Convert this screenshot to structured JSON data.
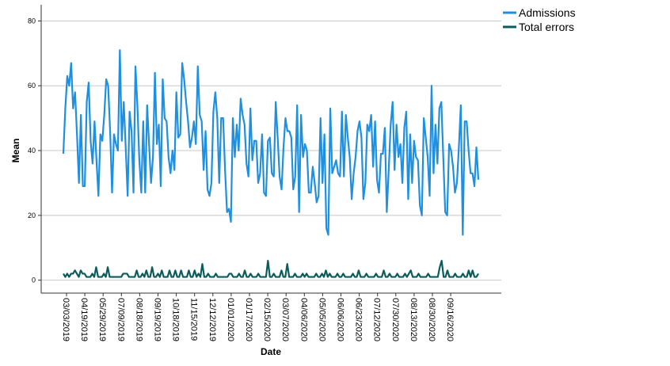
{
  "chart_data": {
    "type": "line",
    "xlabel": "Date",
    "ylabel": "Mean",
    "ylim": [
      -4,
      85
    ],
    "yticks": [
      0,
      20,
      40,
      60,
      80
    ],
    "grid": "horizontal",
    "legend_position": "top-right",
    "x_tick_labels": [
      "03/03/2019",
      "04/19/2019",
      "05/29/2019",
      "07/09/2019",
      "08/18/2019",
      "09/19/2019",
      "10/18/2019",
      "11/15/2019",
      "12/12/2019",
      "01/01/2020",
      "01/17/2020",
      "02/15/2020",
      "03/07/2020",
      "04/06/2020",
      "05/05/2020",
      "06/06/2020",
      "06/23/2020",
      "07/12/2020",
      "07/30/2020",
      "08/13/2020",
      "08/30/2020",
      "09/16/2020"
    ],
    "series": [
      {
        "name": "Admissions",
        "color": "#1f8fe0",
        "values": [
          39,
          53,
          63,
          60,
          67,
          53,
          58,
          45,
          30,
          51,
          29,
          29,
          55,
          61,
          43,
          36,
          49,
          37,
          26,
          45,
          43,
          51,
          62,
          60,
          46,
          27,
          45,
          42,
          40,
          71,
          43,
          55,
          41,
          26,
          52,
          46,
          27,
          66,
          54,
          37,
          27,
          49,
          27,
          54,
          42,
          30,
          38,
          64,
          42,
          48,
          29,
          62,
          50,
          49,
          38,
          33,
          40,
          34,
          58,
          44,
          45,
          67,
          62,
          55,
          49,
          41,
          44,
          49,
          42,
          66,
          51,
          49,
          34,
          46,
          28,
          26,
          30,
          52,
          58,
          50,
          30,
          50,
          50,
          34,
          21,
          22,
          18,
          50,
          38,
          48,
          40,
          56,
          51,
          48,
          36,
          32,
          53,
          37,
          43,
          43,
          30,
          33,
          45,
          27,
          26,
          43,
          44,
          33,
          32,
          55,
          44,
          32,
          28,
          41,
          50,
          46,
          46,
          44,
          28,
          32,
          54,
          21,
          51,
          38,
          42,
          40,
          27,
          27,
          35,
          30,
          24,
          26,
          50,
          30,
          45,
          16,
          14,
          53,
          33,
          35,
          37,
          33,
          32,
          52,
          32,
          51,
          44,
          38,
          25,
          33,
          38,
          46,
          49,
          44,
          25,
          30,
          48,
          46,
          51,
          35,
          49,
          31,
          27,
          39,
          39,
          47,
          21,
          34,
          48,
          55,
          34,
          48,
          38,
          42,
          30,
          47,
          52,
          25,
          45,
          30,
          43,
          38,
          37,
          23,
          20,
          50,
          44,
          38,
          26,
          60,
          33,
          48,
          36,
          53,
          55,
          38,
          21,
          20,
          42,
          40,
          35,
          27,
          30,
          41,
          54,
          14,
          49,
          49,
          40,
          33,
          33,
          29,
          41,
          31
        ]
      },
      {
        "name": "Total errors",
        "color": "#0b5c5a",
        "values": [
          2,
          1,
          2,
          1,
          2,
          2,
          3,
          2,
          1,
          3,
          2,
          2,
          1,
          1,
          1,
          2,
          1,
          4,
          1,
          1,
          1,
          2,
          1,
          4,
          1,
          1,
          1,
          1,
          1,
          1,
          1,
          2,
          2,
          2,
          1,
          1,
          1,
          1,
          3,
          1,
          1,
          2,
          1,
          3,
          1,
          1,
          4,
          1,
          1,
          2,
          1,
          3,
          1,
          1,
          1,
          3,
          1,
          1,
          3,
          1,
          1,
          3,
          1,
          1,
          1,
          3,
          1,
          1,
          3,
          1,
          2,
          1,
          5,
          1,
          1,
          2,
          1,
          1,
          1,
          2,
          1,
          1,
          1,
          1,
          1,
          1,
          2,
          2,
          1,
          1,
          1,
          2,
          1,
          1,
          3,
          1,
          1,
          2,
          1,
          1,
          1,
          2,
          1,
          1,
          1,
          1,
          6,
          1,
          1,
          2,
          1,
          1,
          1,
          3,
          1,
          1,
          5,
          1,
          1,
          1,
          2,
          1,
          1,
          1,
          2,
          1,
          2,
          1,
          1,
          1,
          1,
          2,
          1,
          1,
          2,
          1,
          3,
          1,
          2,
          1,
          1,
          1,
          2,
          1,
          1,
          2,
          1,
          1,
          1,
          1,
          2,
          1,
          1,
          3,
          1,
          1,
          1,
          2,
          1,
          1,
          1,
          1,
          2,
          1,
          1,
          1,
          3,
          1,
          1,
          2,
          1,
          1,
          1,
          2,
          1,
          1,
          1,
          2,
          1,
          2,
          3,
          1,
          1,
          1,
          2,
          1,
          1,
          1,
          1,
          2,
          1,
          1,
          1,
          1,
          1,
          4,
          6,
          1,
          1,
          3,
          1,
          1,
          1,
          2,
          1,
          1,
          1,
          2,
          1,
          1,
          3,
          1,
          3,
          1,
          1,
          2
        ]
      }
    ]
  }
}
